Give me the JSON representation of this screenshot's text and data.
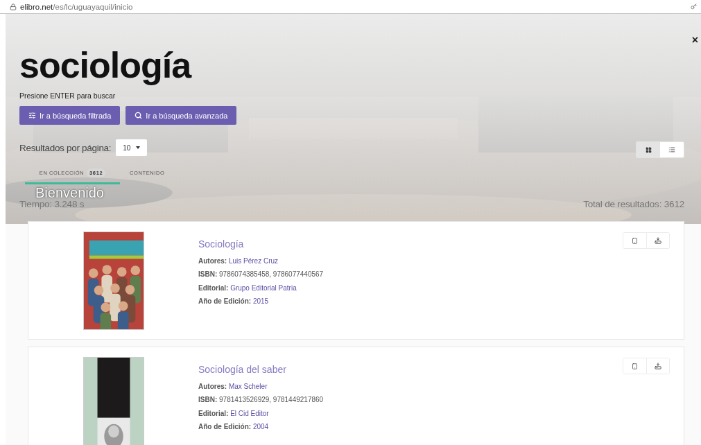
{
  "address_bar": {
    "domain": "elibro.net",
    "path": "/es/lc/uguayaquil/inicio"
  },
  "search": {
    "query": "sociología",
    "hint": "Presione ENTER para buscar"
  },
  "close_label": "×",
  "buttons": [
    {
      "label": "Ir a búsqueda filtrada",
      "kind": "filter"
    },
    {
      "label": "Ir a búsqueda avanzada",
      "kind": "search"
    }
  ],
  "per_page": {
    "label": "Resultados por página:",
    "value": "10"
  },
  "view_toggle": [
    {
      "kind": "grid",
      "selected": true
    },
    {
      "kind": "list",
      "selected": false
    }
  ],
  "tabs": [
    {
      "label": "EN COLECCIÓN",
      "count": "3612",
      "selected": true
    },
    {
      "label": "CONTENIDO",
      "selected": false
    }
  ],
  "background_text": "Bienvenido",
  "time": "Tiempo: 3.248 s",
  "total": "Total de resultados: 3612",
  "results": [
    {
      "title": "Sociología",
      "fields": [
        {
          "label": "Autores:",
          "value": "Luis Pérez Cruz",
          "link": true
        },
        {
          "label": "ISBN:",
          "value": "9786074385458, 9786077440567",
          "link": false
        },
        {
          "label": "Editorial:",
          "value": "Grupo Editorial Patria",
          "link": true
        },
        {
          "label": "Año de Edición:",
          "value": "2015",
          "link": true
        }
      ]
    },
    {
      "title": "Sociología del saber",
      "fields": [
        {
          "label": "Autores:",
          "value": "Max Scheler",
          "link": true
        },
        {
          "label": "ISBN:",
          "value": "9781413526929, 9781449217860",
          "link": false
        },
        {
          "label": "Editorial:",
          "value": "El Cid Editor",
          "link": true
        },
        {
          "label": "Año de Edición:",
          "value": "2004",
          "link": true
        }
      ]
    }
  ]
}
